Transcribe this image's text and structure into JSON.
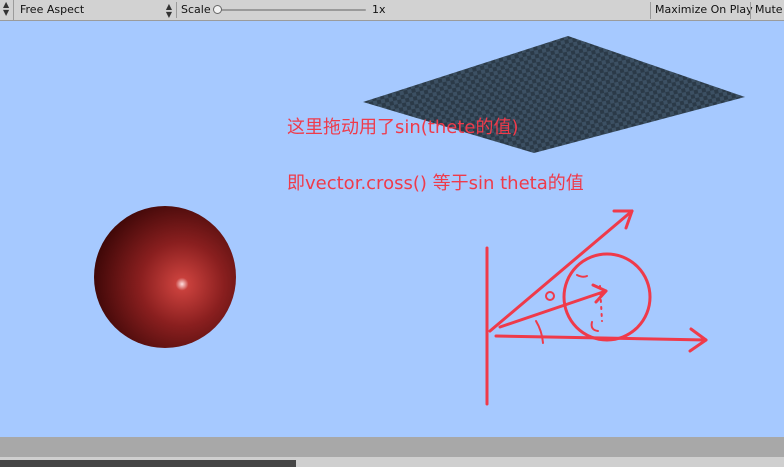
{
  "toolbar": {
    "aspect_label": "Free Aspect",
    "scale_label": "Scale",
    "scale_value": "1x",
    "scale_level": 0.0,
    "maximize_label": "Maximize On Play",
    "mute_label": "Mute A"
  },
  "annotations": {
    "line1": "这里拖动用了sin(thete的值)",
    "line2": "即vector.cross()  等于sin theta的值"
  },
  "colors": {
    "sky": "#a6c9ff",
    "annotation": "#ef3a4a",
    "sphere": "#8a1f1f",
    "plane": "#2e3e4e"
  }
}
